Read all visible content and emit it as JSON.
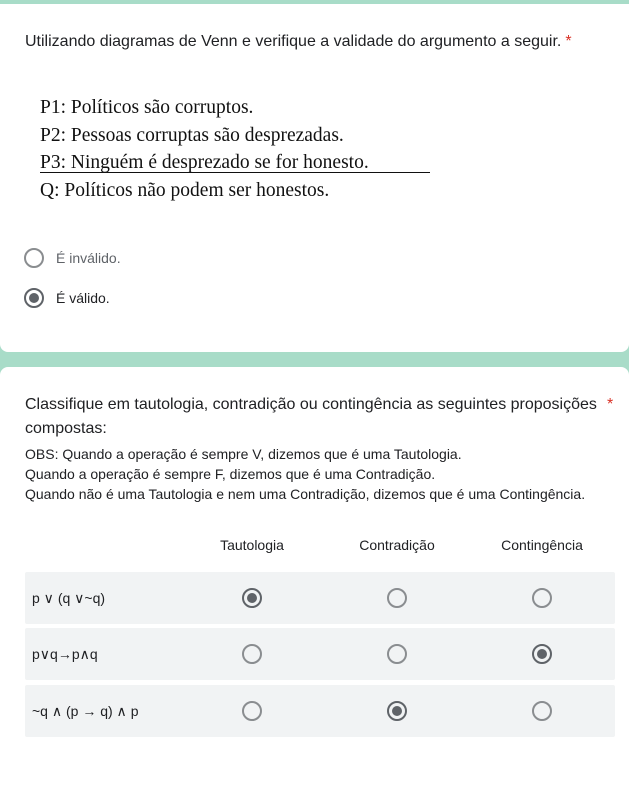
{
  "question1": {
    "title": "Utilizando diagramas de Venn e verifique a  validade do argumento a seguir.",
    "required_mark": "*",
    "premises": [
      "P1: Políticos são corruptos.",
      "P2: Pessoas corruptas são desprezadas.",
      "P3: Ninguém é desprezado se for honesto.",
      "Q: Políticos não podem ser honestos."
    ],
    "options": [
      {
        "label": "É inválido.",
        "selected": false
      },
      {
        "label": "É válido.",
        "selected": true
      }
    ]
  },
  "question2": {
    "title": "Classifique em tautologia, contradição ou contingência as seguintes proposições compostas:",
    "required_mark": "*",
    "obs": [
      "OBS: Quando a operação é sempre V, dizemos que é uma Tautologia.",
      "Quando a operação é sempre F, dizemos que é uma Contradição.",
      "Quando não é uma Tautologia e nem uma Contradição, dizemos que é uma Contingência."
    ],
    "columns": [
      "Tautologia",
      "Contradição",
      "Contingência"
    ],
    "rows": [
      {
        "label": "p ∨ (q ∨~q)",
        "selected": "Tautologia"
      },
      {
        "label": "p∨q→p∧q",
        "selected": "Contingência"
      },
      {
        "label": "~q ∧ (p → q) ∧ p",
        "selected": "Contradição"
      }
    ]
  },
  "colors": {
    "background_accent": "#a8dcc8",
    "required": "#d93025",
    "radio": "#5f6368",
    "row_bg": "#f1f3f4"
  }
}
